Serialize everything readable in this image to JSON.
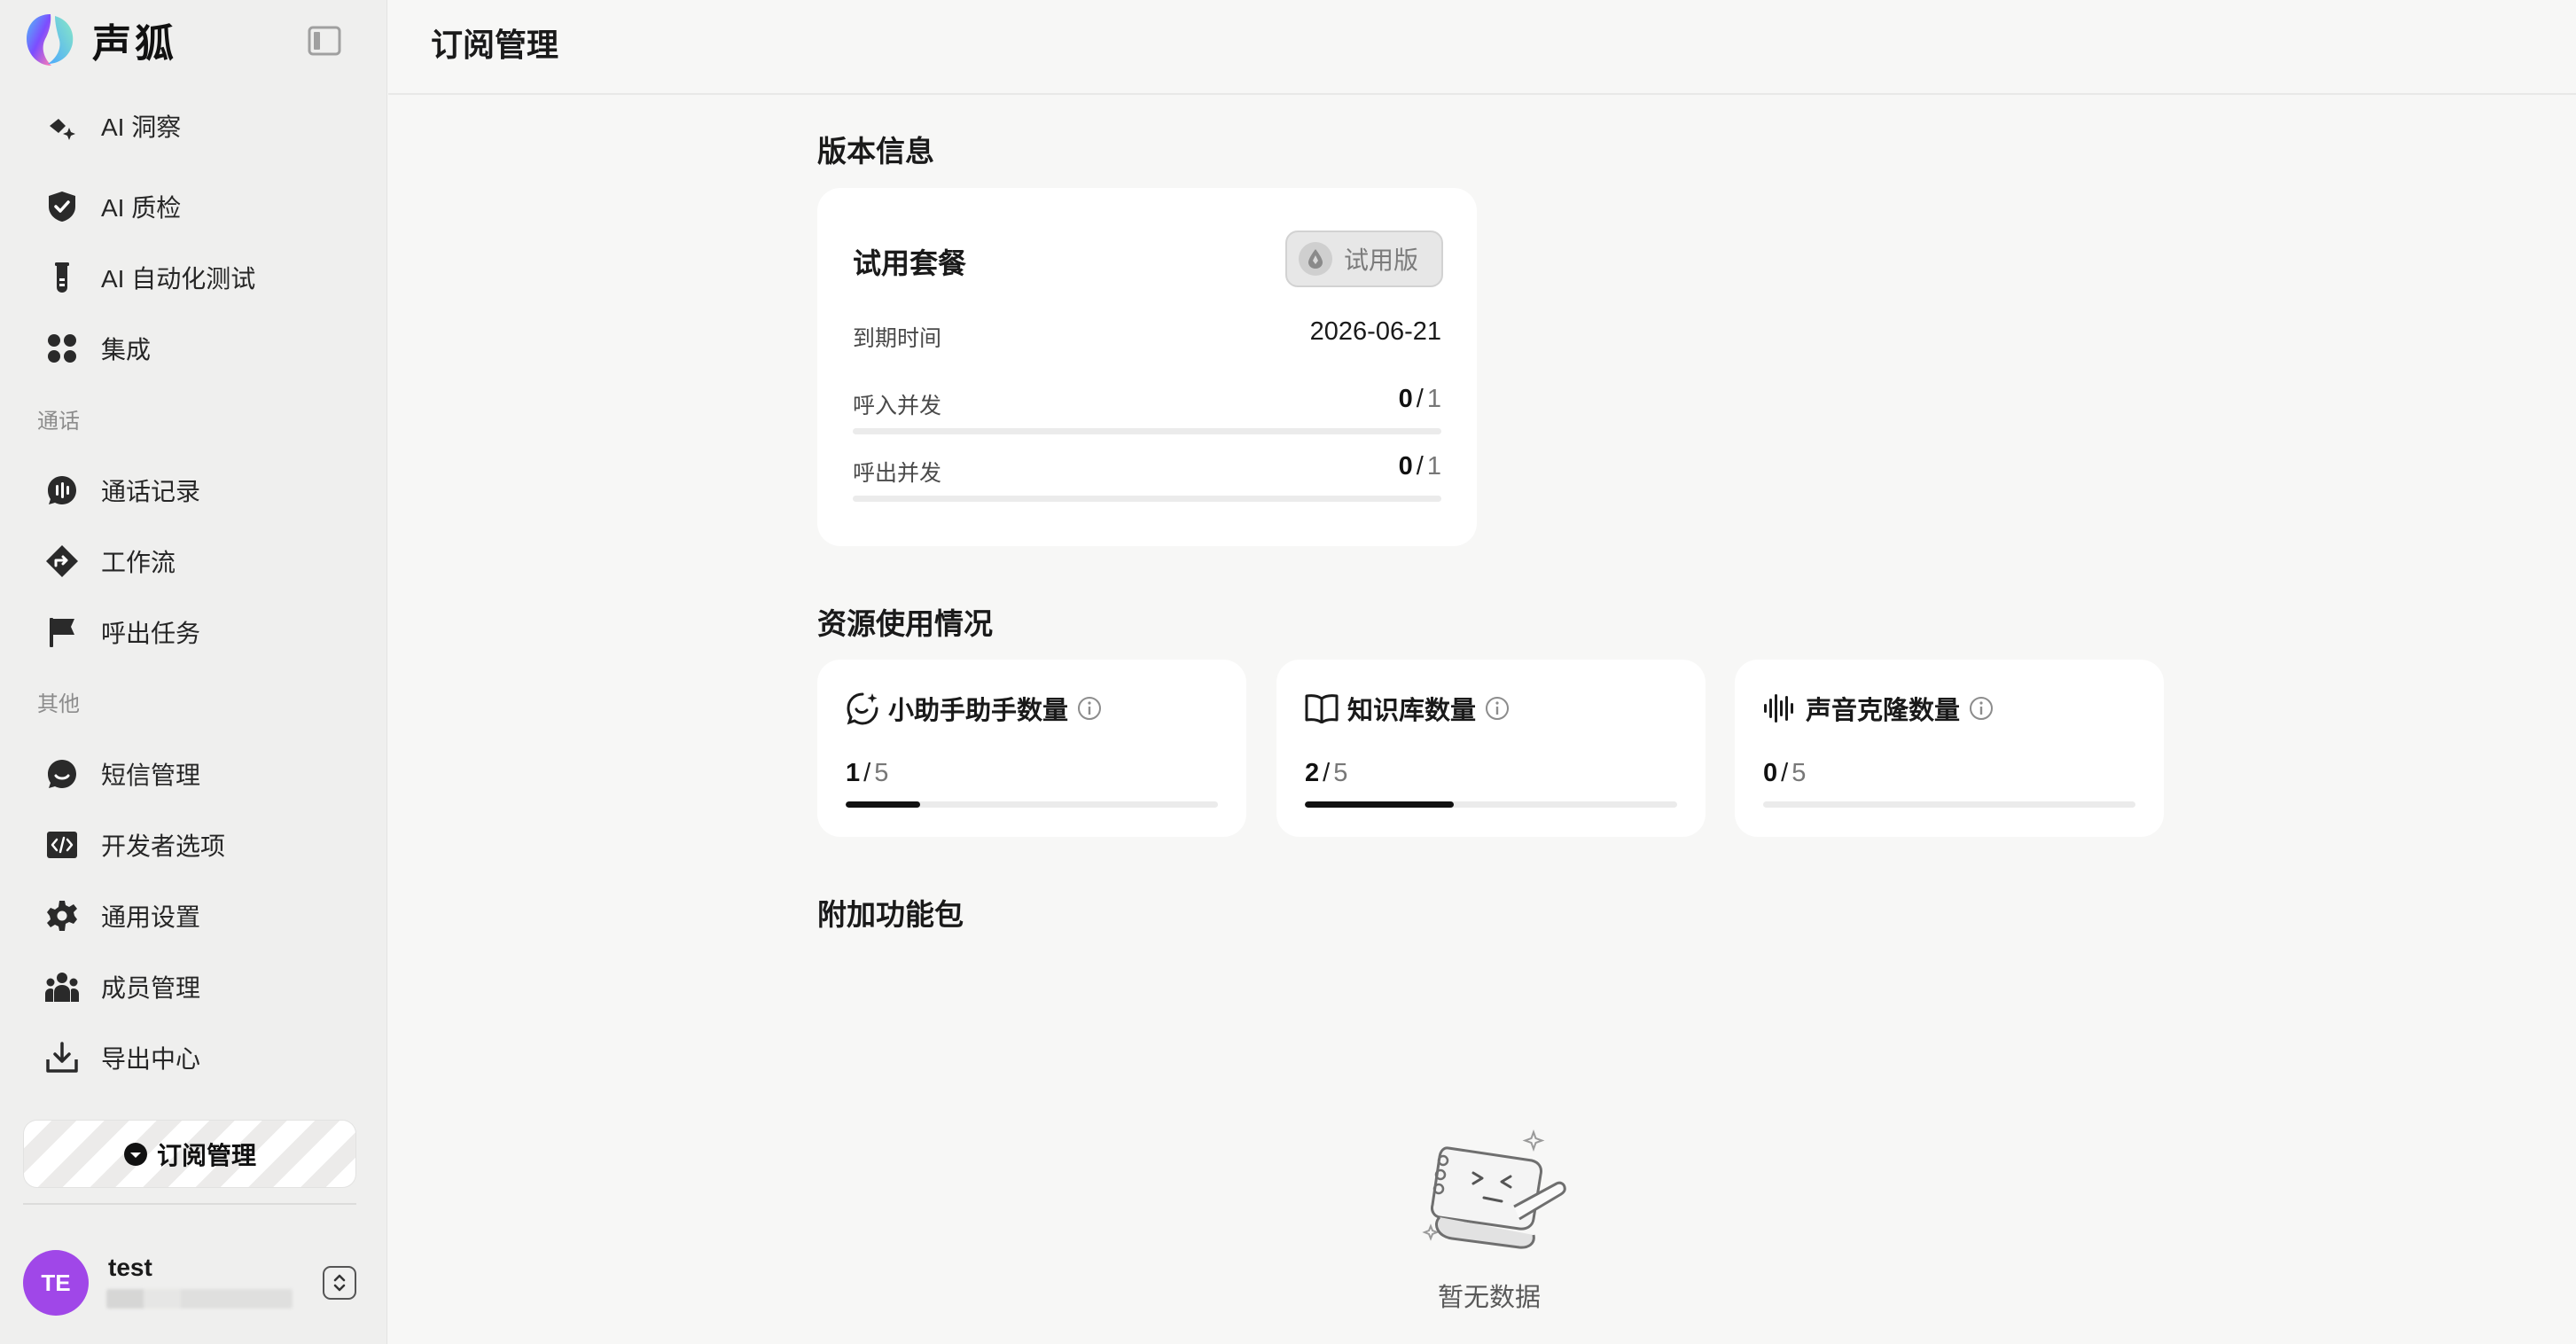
{
  "brand": {
    "name": "声狐"
  },
  "sidebar": {
    "items": [
      {
        "label": "AI 洞察",
        "icon": "sparkle-insight-icon"
      },
      {
        "label": "AI 质检",
        "icon": "shield-check-icon"
      },
      {
        "label": "AI 自动化测试",
        "icon": "test-tube-icon"
      },
      {
        "label": "集成",
        "icon": "grid-apps-icon"
      },
      {
        "label": "通话记录",
        "icon": "audio-bubble-icon"
      },
      {
        "label": "工作流",
        "icon": "workflow-diamond-icon"
      },
      {
        "label": "呼出任务",
        "icon": "flag-icon"
      },
      {
        "label": "短信管理",
        "icon": "chat-bubble-icon"
      },
      {
        "label": "开发者选项",
        "icon": "code-icon"
      },
      {
        "label": "通用设置",
        "icon": "gear-icon"
      },
      {
        "label": "成员管理",
        "icon": "team-icon"
      },
      {
        "label": "导出中心",
        "icon": "download-tray-icon"
      }
    ],
    "sections": {
      "call": "通话",
      "other": "其他"
    },
    "subscription_button": "订阅管理"
  },
  "user": {
    "initials": "TE",
    "name": "test"
  },
  "header": {
    "title": "订阅管理"
  },
  "version_section": {
    "title": "版本信息",
    "plan_name": "试用套餐",
    "plan_badge": "试用版",
    "expiry_label": "到期时间",
    "expiry_value": "2026-06-21",
    "inbound_label": "呼入并发",
    "inbound_used": "0",
    "inbound_total": "1",
    "outbound_label": "呼出并发",
    "outbound_used": "0",
    "outbound_total": "1"
  },
  "resource_section": {
    "title": "资源使用情况",
    "items": [
      {
        "label": "小助手助手数量",
        "icon": "assistant-chat-icon",
        "used": "1",
        "total": "5",
        "fraction": 0.2
      },
      {
        "label": "知识库数量",
        "icon": "open-book-icon",
        "used": "2",
        "total": "5",
        "fraction": 0.4
      },
      {
        "label": "声音克隆数量",
        "icon": "soundwave-icon",
        "used": "0",
        "total": "5",
        "fraction": 0.0
      }
    ]
  },
  "addon_section": {
    "title": "附加功能包",
    "empty_text": "暂无数据"
  },
  "colors": {
    "accent": "#111111",
    "avatar": "#a047e8",
    "track": "#ebebeb"
  }
}
